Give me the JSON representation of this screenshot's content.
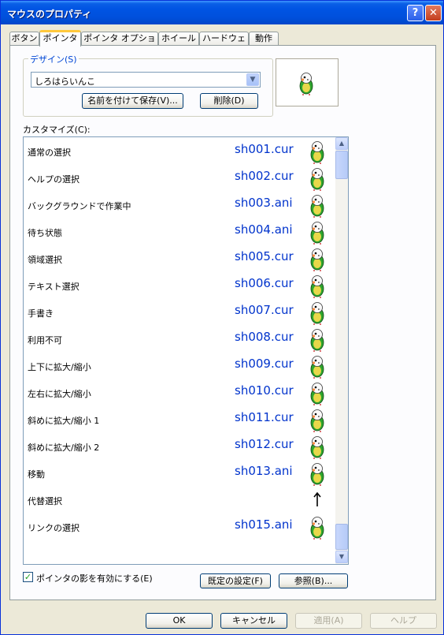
{
  "window": {
    "title": "マウスのプロパティ",
    "help_btn": "?",
    "close_btn": "✕"
  },
  "tabs": [
    {
      "label": "ボタン"
    },
    {
      "label": "ポインタ"
    },
    {
      "label": "ポインタ オプション"
    },
    {
      "label": "ホイール"
    },
    {
      "label": "ハードウェア"
    },
    {
      "label": "動作"
    }
  ],
  "design": {
    "legend": "デザイン(S)",
    "scheme_value": "しろはらいんこ",
    "save_as_label": "名前を付けて保存(V)...",
    "delete_label": "削除(D)"
  },
  "customize": {
    "label": "カスタマイズ(C):",
    "rows": [
      {
        "name": "通常の選択",
        "file": "sh001.cur"
      },
      {
        "name": "ヘルプの選択",
        "file": "sh002.cur"
      },
      {
        "name": "バックグラウンドで作業中",
        "file": "sh003.ani"
      },
      {
        "name": "待ち状態",
        "file": "sh004.ani"
      },
      {
        "name": "領域選択",
        "file": "sh005.cur"
      },
      {
        "name": "テキスト選択",
        "file": "sh006.cur"
      },
      {
        "name": "手書き",
        "file": "sh007.cur"
      },
      {
        "name": "利用不可",
        "file": "sh008.cur"
      },
      {
        "name": "上下に拡大/縮小",
        "file": "sh009.cur"
      },
      {
        "name": "左右に拡大/縮小",
        "file": "sh010.cur"
      },
      {
        "name": "斜めに拡大/縮小 1",
        "file": "sh011.cur"
      },
      {
        "name": "斜めに拡大/縮小 2",
        "file": "sh012.cur"
      },
      {
        "name": "移動",
        "file": "sh013.ani"
      },
      {
        "name": "代替選択",
        "file": ""
      },
      {
        "name": "リンクの選択",
        "file": "sh015.ani"
      }
    ]
  },
  "shadow_checkbox": {
    "label": "ポインタの影を有効にする(E)",
    "checked": true
  },
  "buttons": {
    "default_label": "既定の設定(F)",
    "browse_label": "参照(B)...",
    "ok_label": "OK",
    "cancel_label": "キャンセル",
    "apply_label": "適用(A)",
    "help_label": "ヘルプ"
  },
  "colors": {
    "title_blue": "#0054e3",
    "file_text": "#0033cc",
    "legend_text": "#0046d5"
  },
  "icons": [
    "parrot-cursor-icon",
    "arrow-cursor-icon",
    "checkmark-icon",
    "chevron-down-icon",
    "scroll-up-icon",
    "scroll-down-icon"
  ]
}
